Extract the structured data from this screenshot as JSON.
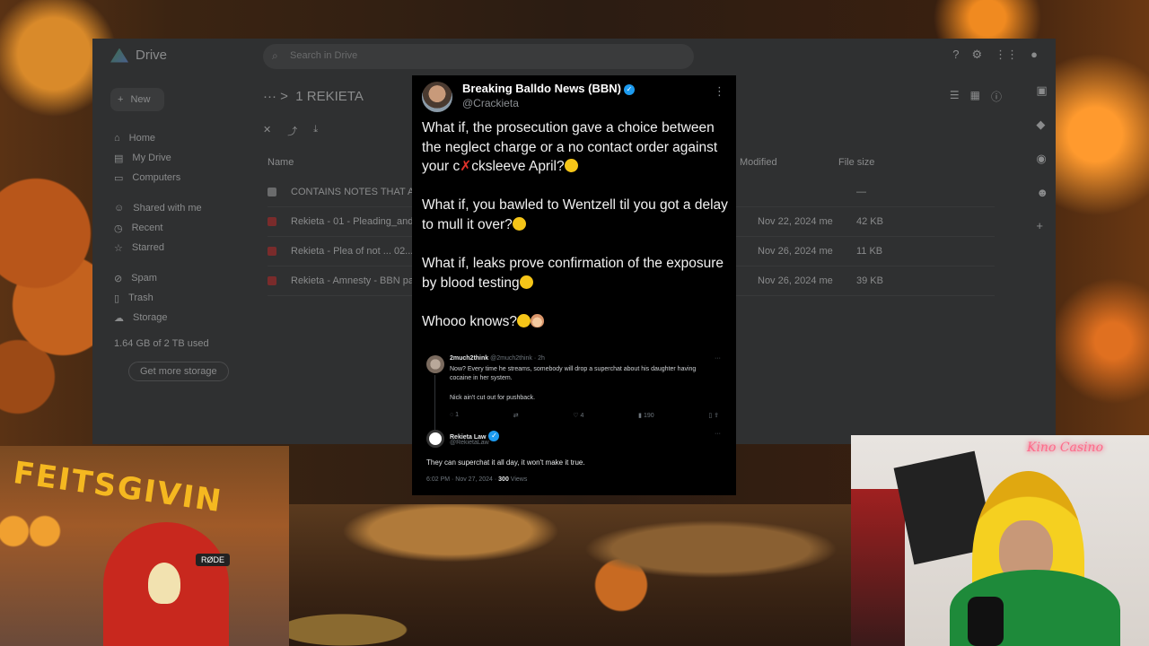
{
  "drive": {
    "app_name": "Drive",
    "search_placeholder": "Search in Drive",
    "new_label": "New",
    "nav": [
      "Home",
      "My Drive",
      "Computers",
      "Shared with me",
      "Recent",
      "Starred",
      "Spam",
      "Trash",
      "Storage"
    ],
    "storage_text": "1.64 GB of 2 TB used",
    "get_storage_label": "Get more storage",
    "breadcrumb": "1 REKIETA",
    "columns": [
      "Name",
      "Modified",
      "File size"
    ],
    "files": [
      {
        "name": "CONTAINS NOTES THAT A...",
        "type": "folder",
        "modified": "",
        "size": "—"
      },
      {
        "name": "Rekieta - 01 - Pleading_and_...",
        "type": "pdf",
        "modified": "Nov 22, 2024 me",
        "size": "42 KB"
      },
      {
        "name": "Rekieta - Plea of not ... 02...",
        "type": "pdf",
        "modified": "Nov 26, 2024 me",
        "size": "11 KB"
      },
      {
        "name": "Rekieta - Amnesty - BBN pa...",
        "type": "pdf",
        "modified": "Nov 26, 2024 me",
        "size": "39 KB"
      }
    ]
  },
  "tweet": {
    "author_name": "Breaking Balldo News (BBN)",
    "author_handle": "@Crackieta",
    "paragraphs": [
      {
        "before": "What if, the prosecution gave a choice between the neglect charge or a no contact order against your c",
        "redacted": "✗",
        "after": "cksleeve April?"
      },
      {
        "text": "What if, you bawled to Wentzell til you got a delay to mull it over?"
      },
      {
        "text": "What if, leaks prove confirmation of the exposure by blood testing"
      },
      {
        "text": "Whooo knows?"
      }
    ],
    "quoted": {
      "name": "2much2think",
      "handle": "@2much2think · 2h",
      "text": "Now? Every time he streams, somebody will drop a superchat about his daughter having cocaine in her system.",
      "text2": "Nick ain't cut out for pushback.",
      "replies": "1",
      "likes": "4",
      "views": "190"
    },
    "reply": {
      "name": "Rekieta Law",
      "handle": "@RekietaLaw",
      "text": "They can superchat it all day, it won't make it true.",
      "meta": "6:02 PM · Nov 27, 2024 · ",
      "views": "300",
      "views_label": " Views"
    }
  },
  "overlay": {
    "left_banner": "FEITSGIVIN",
    "mic_brand": "RØDE",
    "right_sign": "Kino Casino"
  }
}
